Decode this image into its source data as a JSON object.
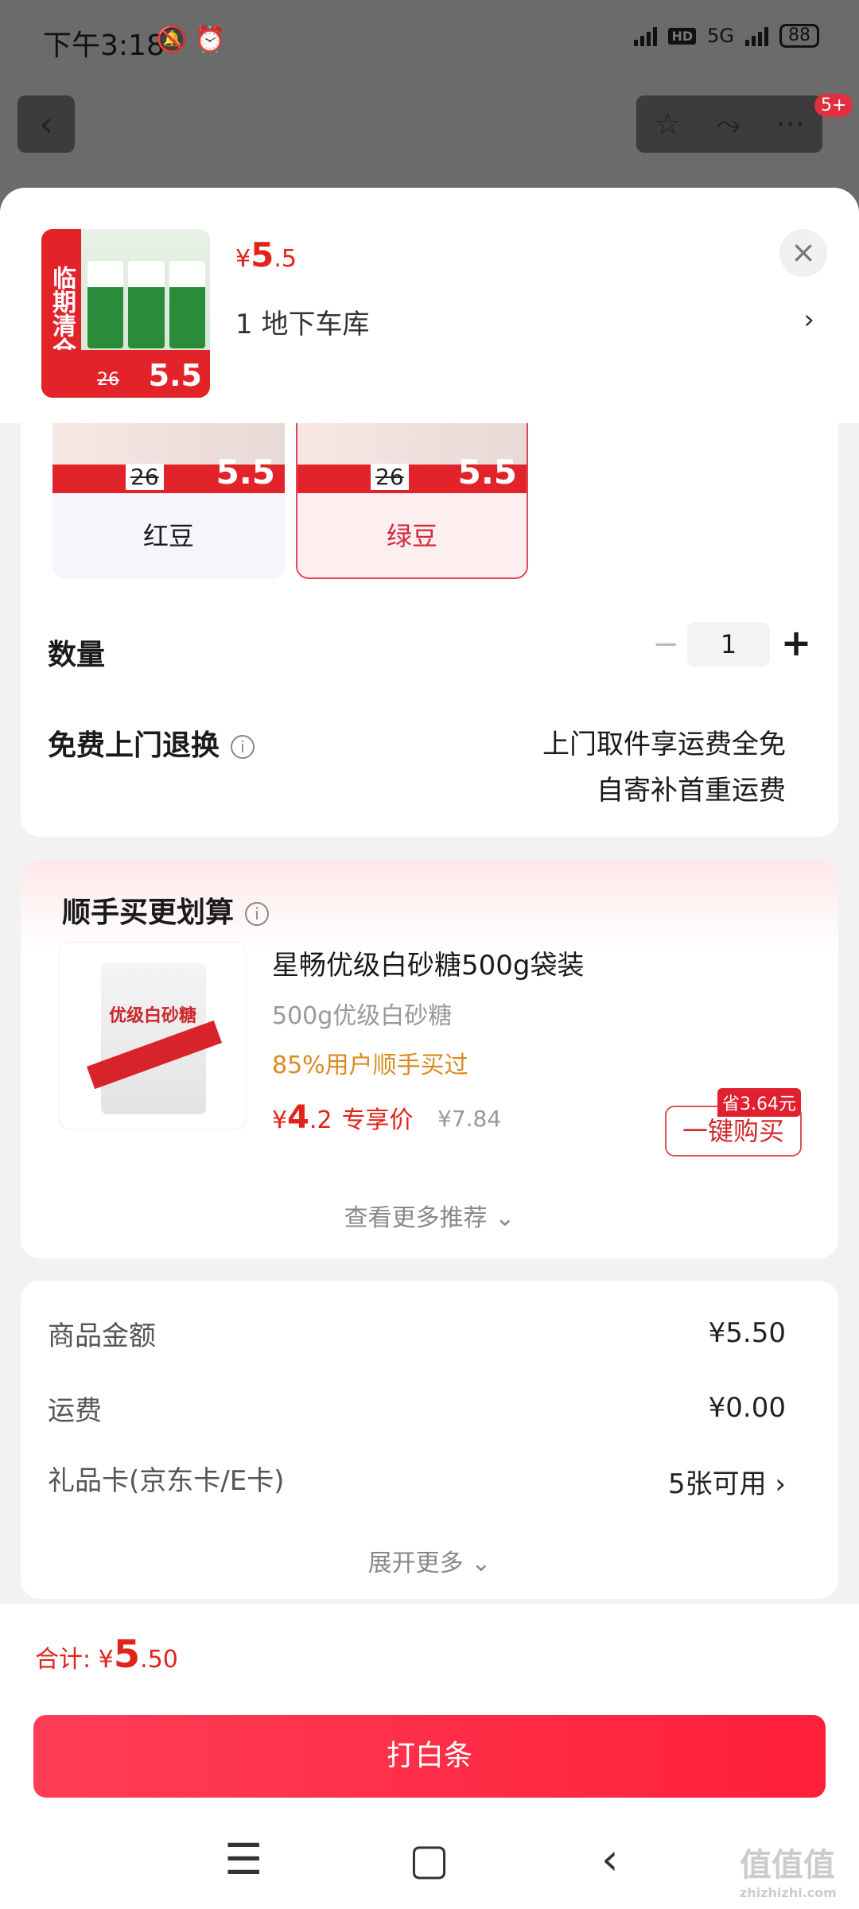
{
  "status_bar": {
    "time": "下午3:18",
    "hd": "HD",
    "net": "5G",
    "battery": "88"
  },
  "top_actions": {
    "back": "‹",
    "star": "☆",
    "share": "⤳",
    "more": "···",
    "badge": "5+"
  },
  "header": {
    "price_symbol": "¥",
    "price_int": "5",
    "price_dec": ".5",
    "thumb_banner": "临期清仓",
    "thumb_price": "5.5",
    "thumb_orig": "26",
    "address": "1  地下车库",
    "address_arrow": "›",
    "close": "×"
  },
  "variants": [
    {
      "label": "红豆",
      "img_price": "5.5",
      "img_orig": "26"
    },
    {
      "label": "绿豆",
      "img_price": "5.5",
      "img_orig": "26"
    }
  ],
  "quantity": {
    "label": "数量",
    "minus": "−",
    "value": "1",
    "plus": "+"
  },
  "return_service": {
    "label": "免费上门退换",
    "info": "i",
    "line1": "上门取件享运费全免",
    "line2": "自寄补首重运费"
  },
  "recommend": {
    "title": "顺手买更划算",
    "info": "i",
    "product": {
      "image_text": "优级白砂糖",
      "name": "星畅优级白砂糖500g袋装",
      "spec": "500g优级白砂糖",
      "social": "85%用户顺手买过",
      "price_symbol": "¥",
      "price_int": "4",
      "price_dec": ".2",
      "price_tag": "专享价",
      "orig_price": "¥7.84",
      "save_tag": "省3.64元",
      "buy_label": "一键购买"
    },
    "more": "查看更多推荐 ⌄"
  },
  "costs": {
    "rows": [
      {
        "label": "商品金额",
        "value": "¥5.50"
      },
      {
        "label": "运费",
        "value": "¥0.00"
      },
      {
        "label": "礼品卡(京东卡/E卡)",
        "value": "5张可用 ›"
      }
    ],
    "expand": "展开更多 ⌄"
  },
  "footer": {
    "total_label": "合计: ",
    "total_symbol": "¥",
    "total_int": "5",
    "total_dec": ".50",
    "pay_label": "打白条"
  },
  "nav": {
    "menu": "☰",
    "home": "▢",
    "back": "‹"
  },
  "watermark": {
    "main": "值值值",
    "sub": "zhizhizhi.com"
  },
  "colors": {
    "accent": "#e2231a",
    "button": "#ff2a45"
  }
}
